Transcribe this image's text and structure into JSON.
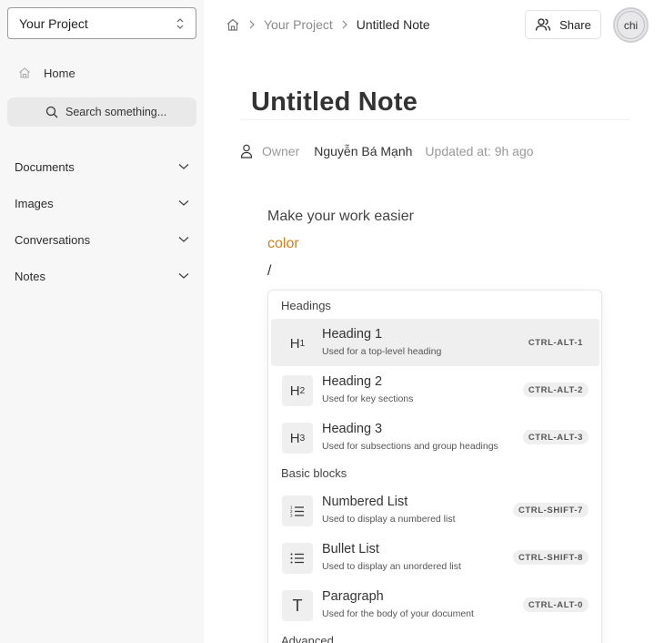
{
  "sidebar": {
    "project": "Your Project",
    "home": "Home",
    "search_placeholder": "Search something...",
    "sections": [
      "Documents",
      "Images",
      "Conversations",
      "Notes"
    ]
  },
  "header": {
    "breadcrumb": [
      "Your Project",
      "Untitled Note"
    ],
    "share_label": "Share",
    "avatar_initials": "chi"
  },
  "note": {
    "title": "Untitled Note",
    "owner_label": "Owner",
    "owner_name": "Nguyễn Bá Mạnh",
    "updated": "Updated at: 9h ago",
    "lines": [
      "Make your work easier",
      "color",
      "/"
    ],
    "accent_color": "#d47f1a"
  },
  "slash_menu": {
    "groups": [
      {
        "label": "Headings",
        "items": [
          {
            "icon": "H",
            "sub": "1",
            "name": "Heading 1",
            "desc": "Used for a top-level heading",
            "shortcut": "CTRL-ALT-1",
            "active": true
          },
          {
            "icon": "H",
            "sub": "2",
            "name": "Heading 2",
            "desc": "Used for key sections",
            "shortcut": "CTRL-ALT-2"
          },
          {
            "icon": "H",
            "sub": "3",
            "name": "Heading 3",
            "desc": "Used for subsections and group headings",
            "shortcut": "CTRL-ALT-3"
          }
        ]
      },
      {
        "label": "Basic blocks",
        "items": [
          {
            "icon": "numbered-list-icon",
            "name": "Numbered List",
            "desc": "Used to display a numbered list",
            "shortcut": "CTRL-SHIFT-7"
          },
          {
            "icon": "bullet-list-icon",
            "name": "Bullet List",
            "desc": "Used to display an unordered list",
            "shortcut": "CTRL-SHIFT-8"
          },
          {
            "icon": "T",
            "name": "Paragraph",
            "desc": "Used for the body of your document",
            "shortcut": "CTRL-ALT-0"
          }
        ]
      },
      {
        "label": "Advanced",
        "items": []
      }
    ]
  }
}
